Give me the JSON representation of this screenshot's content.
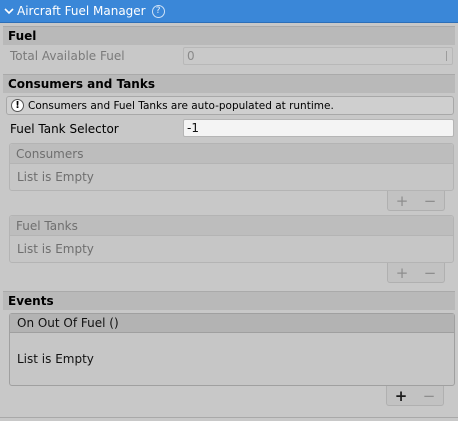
{
  "header": {
    "title": "Aircraft Fuel Manager"
  },
  "fuel": {
    "section_label": "Fuel",
    "total_label": "Total Available Fuel",
    "total_value": "0"
  },
  "consumers_tanks": {
    "section_label": "Consumers and Tanks",
    "info_text": "Consumers and Fuel Tanks are auto-populated at runtime.",
    "selector_label": "Fuel Tank Selector",
    "selector_value": "-1",
    "consumers": {
      "header": "Consumers",
      "empty": "List is Empty"
    },
    "fuel_tanks": {
      "header": "Fuel Tanks",
      "empty": "List is Empty"
    },
    "plus_label": "+",
    "minus_label": "−"
  },
  "events": {
    "section_label": "Events",
    "event_header": "On Out Of Fuel ()",
    "empty": "List is Empty",
    "plus_label": "+",
    "minus_label": "−"
  },
  "colors": {
    "header_bg": "#3a87d8",
    "panel_bg": "#c8c8c8"
  }
}
